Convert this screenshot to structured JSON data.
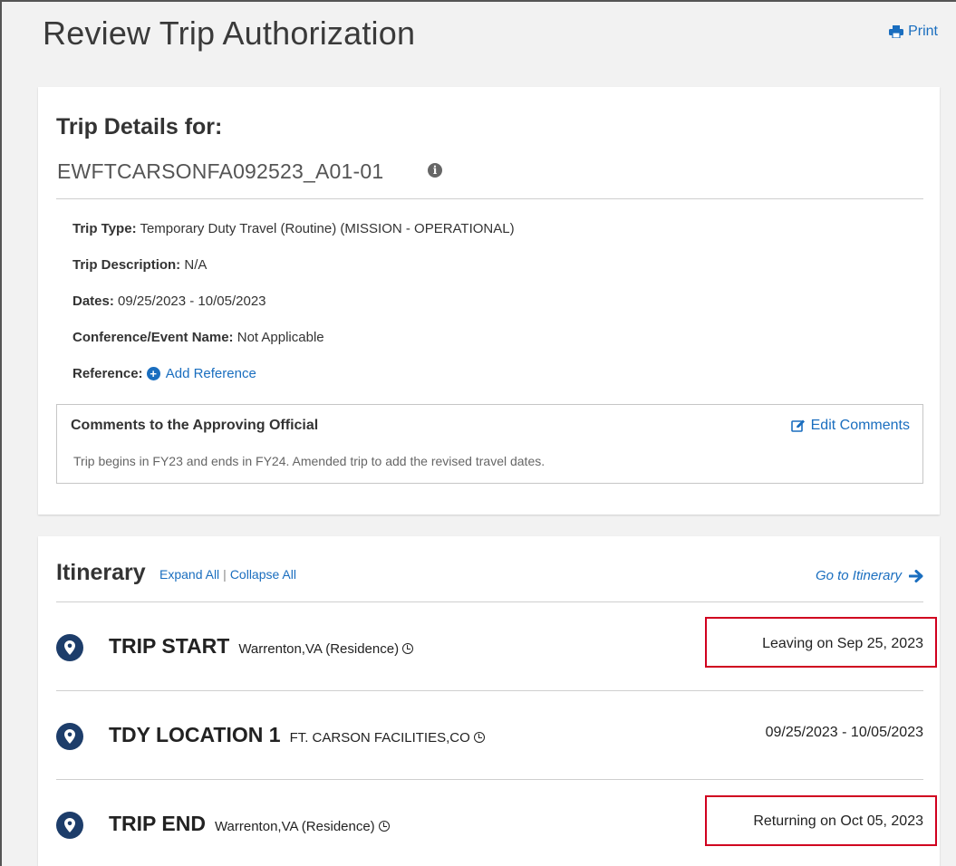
{
  "page": {
    "title": "Review Trip Authorization",
    "print_label": "Print"
  },
  "details": {
    "heading": "Trip Details for:",
    "trip_id": "EWFTCARSONFA092523_A01-01",
    "rows": [
      {
        "label": "Trip Type:",
        "value": " Temporary Duty Travel (Routine) (MISSION - OPERATIONAL)"
      },
      {
        "label": "Trip Description:",
        "value": " N/A"
      },
      {
        "label": "Dates:",
        "value": " 09/25/2023 - 10/05/2023"
      },
      {
        "label": "Conference/Event Name:",
        "value": " Not Applicable"
      }
    ],
    "reference_label": "Reference:",
    "add_reference": "Add Reference",
    "comments_title": "Comments to the Approving Official",
    "edit_comments": "Edit Comments",
    "comments_text": "Trip begins in FY23 and ends in FY24. Amended trip to add the revised travel dates."
  },
  "itinerary": {
    "heading": "Itinerary",
    "expand_all": "Expand All",
    "separator": "|",
    "collapse_all": "Collapse All",
    "goto": "Go to Itinerary",
    "stops": [
      {
        "title": "TRIP START",
        "location": "Warrenton,VA (Residence)",
        "date": "Leaving on Sep 25, 2023"
      },
      {
        "title": "TDY LOCATION 1",
        "location": "FT. CARSON FACILITIES,CO",
        "date": "09/25/2023 - 10/05/2023"
      },
      {
        "title": "TRIP END",
        "location": "Warrenton,VA (Residence)",
        "date": "Returning on Oct 05, 2023"
      }
    ]
  },
  "colors": {
    "link": "#1a6ebf",
    "pin": "#1d3d6a",
    "highlight": "#d0001f"
  }
}
